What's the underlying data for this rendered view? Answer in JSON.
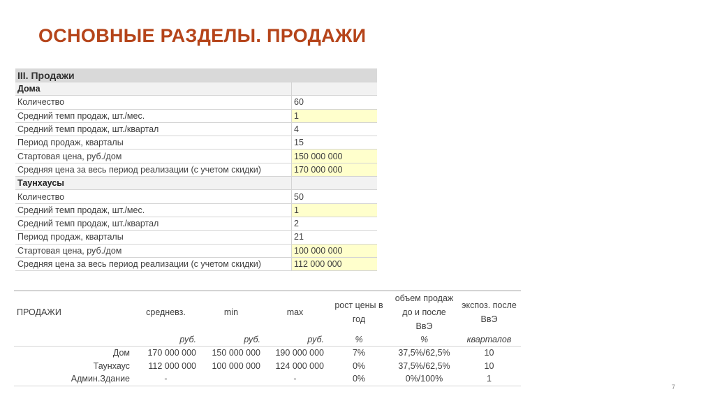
{
  "slide": {
    "title": "ОСНОВНЫЕ РАЗДЕЛЫ. ПРОДАЖИ",
    "page_number": "7"
  },
  "params_table": {
    "header": "III. Продажи",
    "sections": [
      {
        "name": "Дома",
        "rows": [
          {
            "label": "Количество",
            "value": "60",
            "highlight": false
          },
          {
            "label": "Средний темп продаж, шт./мес.",
            "value": "1",
            "highlight": true
          },
          {
            "label": "Средний темп продаж, шт./квартал",
            "value": "4",
            "highlight": false
          },
          {
            "label": "Период продаж, кварталы",
            "value": "15",
            "highlight": false
          },
          {
            "label": "Стартовая цена, руб./дом",
            "value": "150 000 000",
            "highlight": true
          },
          {
            "label": "Средняя цена за весь период реализации (с учетом скидки)",
            "value": "170 000 000",
            "highlight": true
          }
        ]
      },
      {
        "name": "Таунхаусы",
        "rows": [
          {
            "label": "Количество",
            "value": "50",
            "highlight": false
          },
          {
            "label": "Средний темп продаж, шт./мес.",
            "value": "1",
            "highlight": true
          },
          {
            "label": "Средний темп продаж, шт./квартал",
            "value": "2",
            "highlight": false
          },
          {
            "label": "Период продаж, кварталы",
            "value": "21",
            "highlight": false
          },
          {
            "label": "Стартовая цена, руб./дом",
            "value": "100 000 000",
            "highlight": true
          },
          {
            "label": "Средняя цена за весь период реализации (с учетом скидки)",
            "value": "112 000 000",
            "highlight": true
          }
        ]
      }
    ]
  },
  "sales_table": {
    "headers": [
      "ПРОДАЖИ",
      "средневз.",
      "min",
      "max",
      "рост цены в год",
      "объем продаж до и после ВвЭ",
      "экспоз. после ВвЭ"
    ],
    "units": [
      "",
      "руб.",
      "руб.",
      "руб.",
      "%",
      "%",
      "кварталов"
    ],
    "rows": [
      [
        "Дом",
        "170 000 000",
        "150 000 000",
        "190 000 000",
        "7%",
        "37,5%/62,5%",
        "10"
      ],
      [
        "Таунхаус",
        "112 000 000",
        "100 000 000",
        "124 000 000",
        "0%",
        "37,5%/62,5%",
        "10"
      ],
      [
        "Админ.Здание",
        "-",
        "",
        "-",
        "0%",
        "0%/100%",
        "1"
      ]
    ]
  }
}
